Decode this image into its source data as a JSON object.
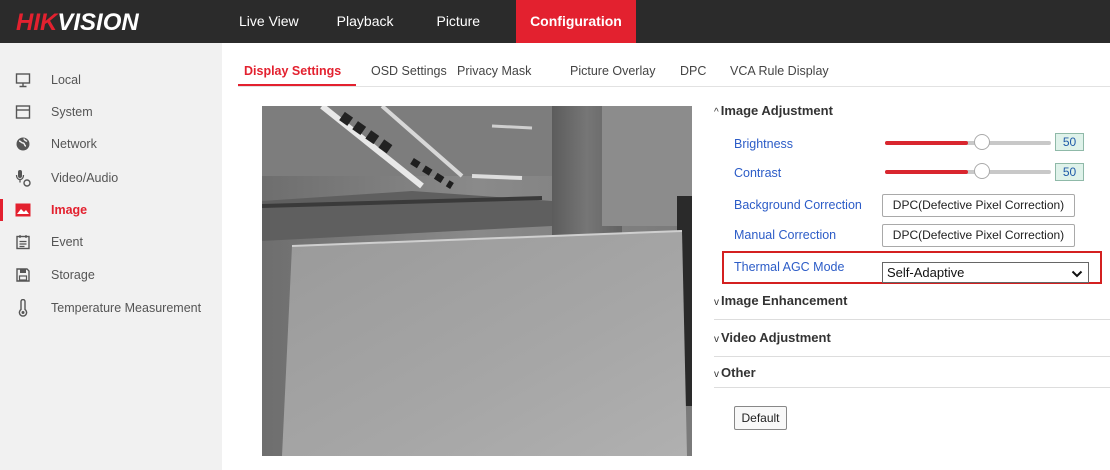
{
  "brand": {
    "part1": "HIK",
    "part2": "VISION"
  },
  "topnav": [
    "Live View",
    "Playback",
    "Picture",
    "Configuration"
  ],
  "sidebar": {
    "items": [
      {
        "label": "Local",
        "icon": "monitor-icon"
      },
      {
        "label": "System",
        "icon": "window-icon"
      },
      {
        "label": "Network",
        "icon": "globe-icon"
      },
      {
        "label": "Video/Audio",
        "icon": "microphone-icon"
      },
      {
        "label": "Image",
        "icon": "image-icon"
      },
      {
        "label": "Event",
        "icon": "calendar-icon"
      },
      {
        "label": "Storage",
        "icon": "floppy-disk-icon"
      },
      {
        "label": "Temperature Measurement",
        "icon": "thermometer-icon"
      }
    ],
    "active": "Image"
  },
  "subtabs": [
    "Display Settings",
    "OSD Settings",
    "Privacy Mask",
    "Picture Overlay",
    "DPC",
    "VCA Rule Display"
  ],
  "panel": {
    "image_adjustment": {
      "title": "Image Adjustment",
      "brightness": {
        "label": "Brightness",
        "value": "50",
        "level": 0.5
      },
      "contrast": {
        "label": "Contrast",
        "value": "50",
        "level": 0.5
      },
      "background_correction": {
        "label": "Background Correction",
        "button": "DPC(Defective Pixel Correction)"
      },
      "manual_correction": {
        "label": "Manual Correction",
        "button": "DPC(Defective Pixel Correction)"
      },
      "agc_mode": {
        "label": "Thermal AGC Mode",
        "value": "Self-Adaptive"
      }
    },
    "image_enhancement": "Image Enhancement",
    "video_adjustment": "Video Adjustment",
    "other": "Other",
    "default_button": "Default"
  },
  "colors": {
    "accent": "#e3212f",
    "link": "#2c5cc7",
    "topbar": "#2b2b2b"
  }
}
